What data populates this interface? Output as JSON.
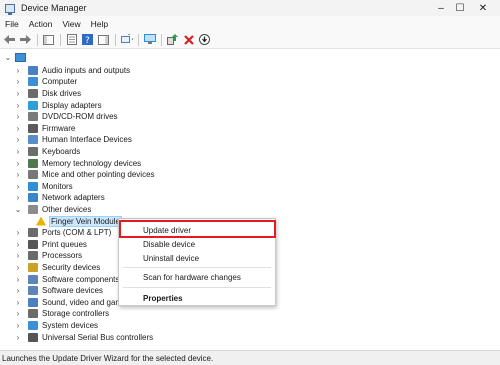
{
  "window": {
    "title": "Device Manager",
    "icon": "device-manager-icon",
    "controls": {
      "minimize": "–",
      "maximize": "☐",
      "close": "✕"
    }
  },
  "menu": [
    "File",
    "Action",
    "View",
    "Help"
  ],
  "toolbar": {
    "buttons": [
      "back-arrow-icon",
      "forward-arrow-icon",
      "show-hide-tree-icon",
      "properties-icon",
      "help-icon",
      "show-hide-action-pane-icon",
      "scan-hardware-icon",
      "monitor-icon",
      "update-driver-icon",
      "uninstall-x-icon",
      "download-icon"
    ]
  },
  "tree": {
    "root_label": "",
    "categories": [
      {
        "label": "Audio inputs and outputs",
        "icon": "speaker-icon",
        "color": "#4a7fc1"
      },
      {
        "label": "Computer",
        "icon": "computer-icon",
        "color": "#3d8fd6"
      },
      {
        "label": "Disk drives",
        "icon": "disk-icon",
        "color": "#6b6b6b"
      },
      {
        "label": "Display adapters",
        "icon": "display-icon",
        "color": "#2e9fd8"
      },
      {
        "label": "DVD/CD-ROM drives",
        "icon": "dvd-icon",
        "color": "#7a7a7a"
      },
      {
        "label": "Firmware",
        "icon": "firmware-icon",
        "color": "#5b5b5b"
      },
      {
        "label": "Human Interface Devices",
        "icon": "hid-icon",
        "color": "#5a8ec9"
      },
      {
        "label": "Keyboards",
        "icon": "keyboard-icon",
        "color": "#6d6d6d"
      },
      {
        "label": "Memory technology devices",
        "icon": "memory-icon",
        "color": "#4d7a4d"
      },
      {
        "label": "Mice and other pointing devices",
        "icon": "mouse-icon",
        "color": "#777777"
      },
      {
        "label": "Monitors",
        "icon": "monitor-icon",
        "color": "#2e8fd8"
      },
      {
        "label": "Network adapters",
        "icon": "network-icon",
        "color": "#3b86c9"
      },
      {
        "label": "Other devices",
        "icon": "other-devices-icon",
        "color": "#8c8c8c",
        "expanded": true
      },
      {
        "label": "Finger Vein Module",
        "icon": "unknown-device-warning-icon",
        "color": "#e8b400",
        "child": true,
        "selected": true
      },
      {
        "label": "Ports (COM & LPT)",
        "icon": "port-icon",
        "color": "#6b6b6b"
      },
      {
        "label": "Print queues",
        "icon": "printer-icon",
        "color": "#555555"
      },
      {
        "label": "Processors",
        "icon": "processor-icon",
        "color": "#6b6b6b"
      },
      {
        "label": "Security devices",
        "icon": "security-icon",
        "color": "#c9a227"
      },
      {
        "label": "Software components",
        "icon": "software-component-icon",
        "color": "#5c86b8"
      },
      {
        "label": "Software devices",
        "icon": "software-device-icon",
        "color": "#5c86b8"
      },
      {
        "label": "Sound, video and game controllers",
        "icon": "sound-icon",
        "color": "#4a7fc1"
      },
      {
        "label": "Storage controllers",
        "icon": "storage-icon",
        "color": "#6b6b6b"
      },
      {
        "label": "System devices",
        "icon": "system-icon",
        "color": "#3d8fd6"
      },
      {
        "label": "Universal Serial Bus controllers",
        "icon": "usb-icon",
        "color": "#555555"
      }
    ]
  },
  "context_menu": {
    "items": [
      {
        "label": "Update driver",
        "bold": false
      },
      {
        "label": "Disable device",
        "bold": false
      },
      {
        "label": "Uninstall device",
        "bold": false
      },
      {
        "label": "Scan for hardware changes",
        "bold": false
      },
      {
        "label": "Properties",
        "bold": true
      }
    ],
    "highlight_color": "#e31b23"
  },
  "status_bar": "Launches the Update Driver Wizard for the selected device."
}
